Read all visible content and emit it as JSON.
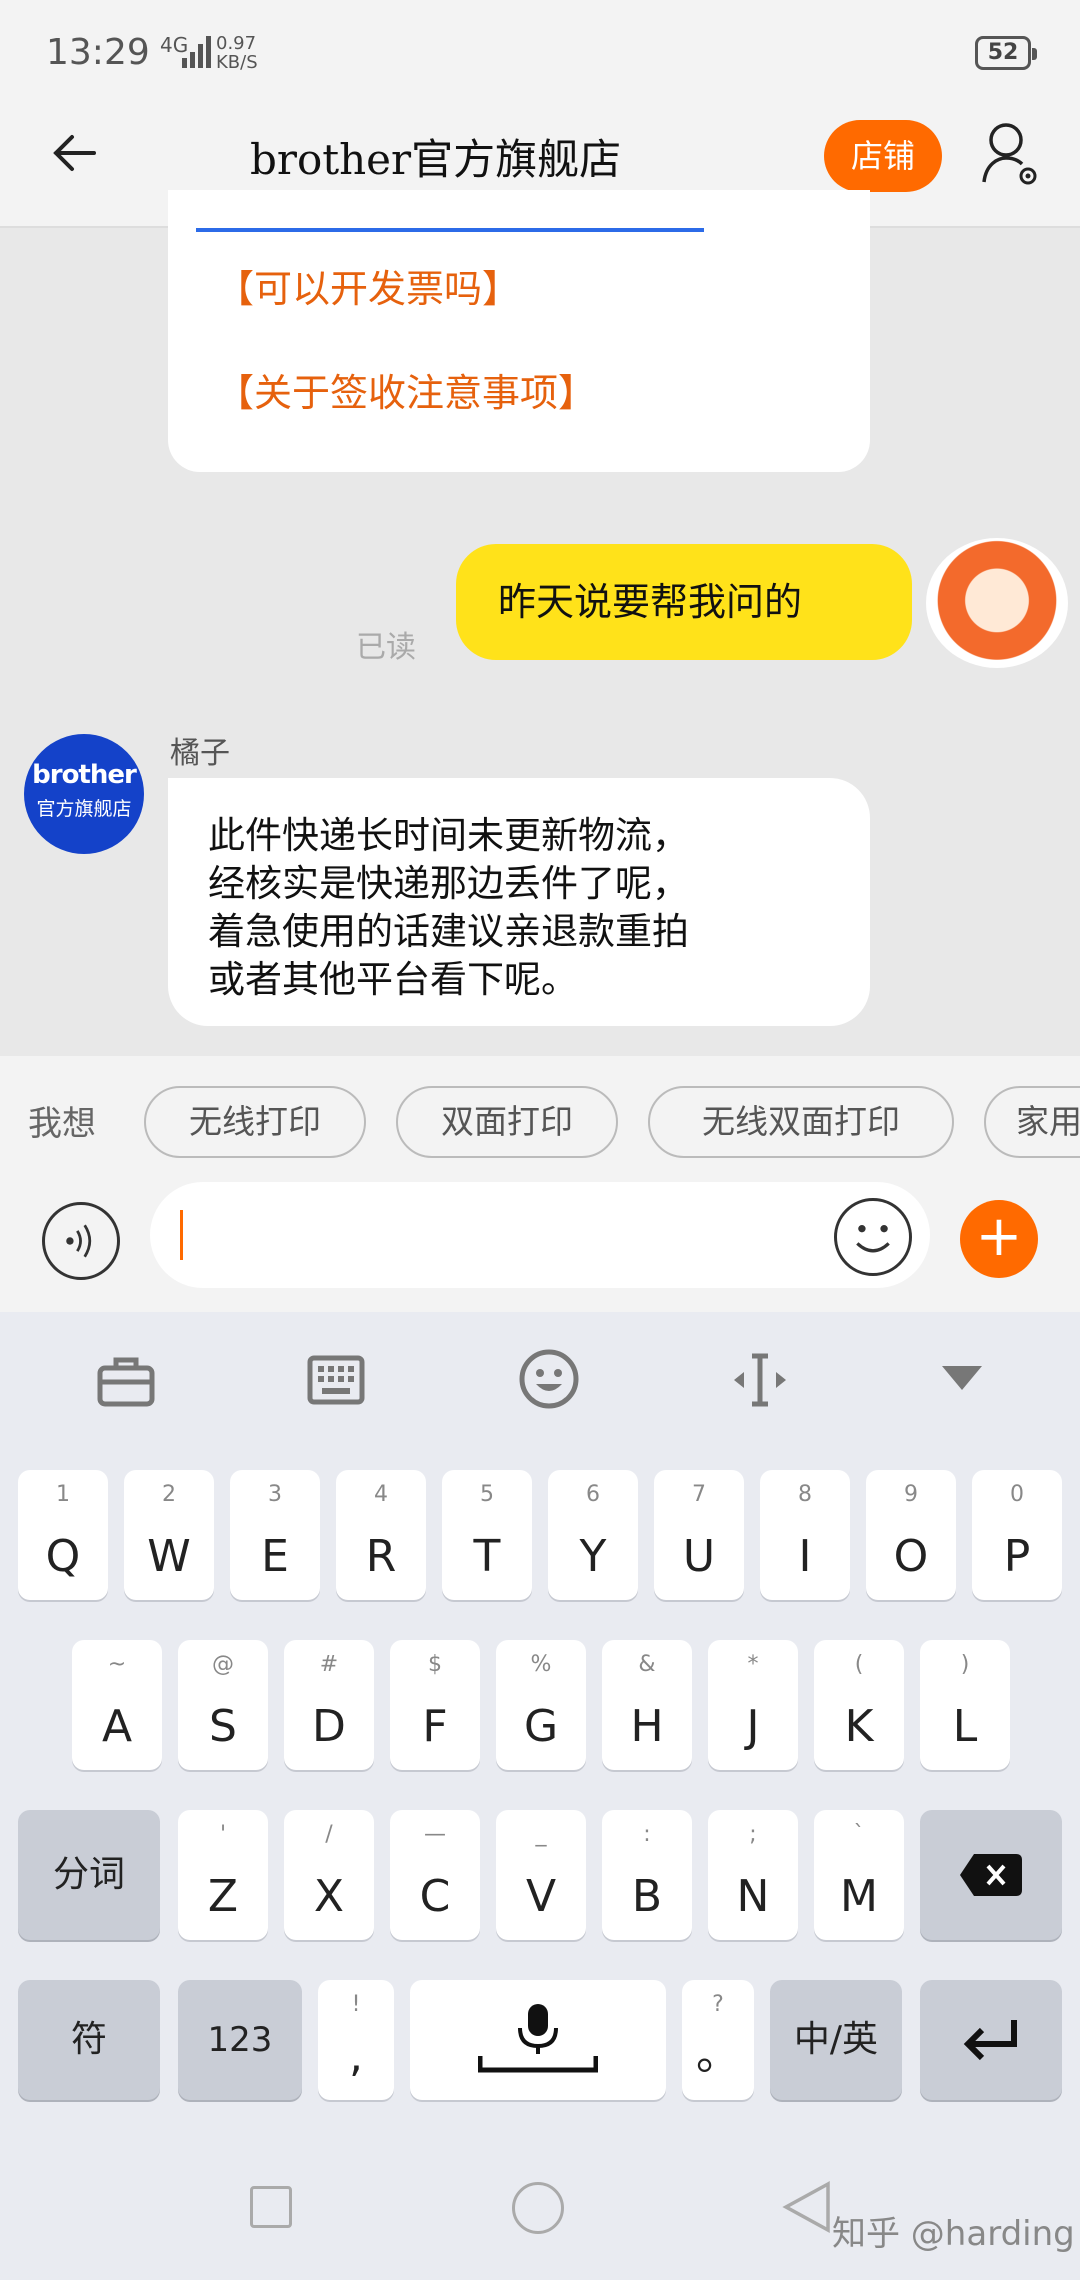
{
  "status": {
    "time": "13:29",
    "network": "4G",
    "speed_value": "0.97",
    "speed_unit": "KB/S",
    "battery": "52"
  },
  "header": {
    "title": "brother官方旗舰店",
    "shop_label": "店铺"
  },
  "chat": {
    "faq_items": [
      "【可以开发票吗】",
      "【关于签收注意事项】"
    ],
    "my_message": "昨天说要帮我问的",
    "read_status": "已读",
    "shop_avatar_line1": "brother",
    "shop_avatar_line2": "官方旗舰店",
    "agent_name": "橘子",
    "agent_message_lines": [
      "此件快递长时间未更新物流，",
      "经核实是快递那边丢件了呢，",
      "着急使用的话建议亲退款重拍",
      "或者其他平台看下呢。"
    ]
  },
  "quick": {
    "label": "我想",
    "chips": [
      "无线打印",
      "双面打印",
      "无线双面打印",
      "家用"
    ]
  },
  "keyboard": {
    "row1": [
      [
        "1",
        "Q"
      ],
      [
        "2",
        "W"
      ],
      [
        "3",
        "E"
      ],
      [
        "4",
        "R"
      ],
      [
        "5",
        "T"
      ],
      [
        "6",
        "Y"
      ],
      [
        "7",
        "U"
      ],
      [
        "8",
        "I"
      ],
      [
        "9",
        "O"
      ],
      [
        "0",
        "P"
      ]
    ],
    "row2": [
      [
        "~",
        "A"
      ],
      [
        "@",
        "S"
      ],
      [
        "#",
        "D"
      ],
      [
        "$",
        "F"
      ],
      [
        "%",
        "G"
      ],
      [
        "&",
        "H"
      ],
      [
        "*",
        "J"
      ],
      [
        "(",
        "K"
      ],
      [
        ")",
        "L"
      ]
    ],
    "row3": [
      [
        "'",
        "Z"
      ],
      [
        "/",
        "X"
      ],
      [
        "—",
        "C"
      ],
      [
        "_",
        "V"
      ],
      [
        ":",
        "B"
      ],
      [
        ";",
        "N"
      ],
      [
        "`",
        "M"
      ]
    ],
    "fenci": "分词",
    "fu": "符",
    "num": "123",
    "comma_top": "!",
    "comma_main": ",",
    "period_top": "?",
    "period_main": "。",
    "lang": "中/英"
  },
  "watermark": "知乎 @harding",
  "colors": {
    "accent": "#ff6a00",
    "my_bubble": "#ffe21a",
    "faq_text": "#e6610d",
    "shop_avatar": "#1442c9"
  }
}
